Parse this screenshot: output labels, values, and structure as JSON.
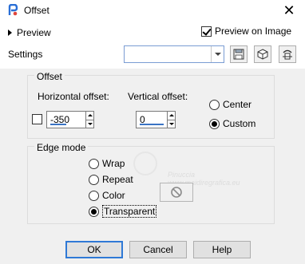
{
  "window": {
    "title": "Offset",
    "close_glyph": "✕"
  },
  "top": {
    "preview_label": "Preview",
    "preview_on_image_label": "Preview on Image",
    "preview_on_image_checked": true,
    "settings_label": "Settings",
    "settings_value": ""
  },
  "offset": {
    "group_title": "Offset",
    "horizontal_label": "Horizontal offset:",
    "horizontal_value": "-350",
    "vertical_label": "Vertical offset:",
    "vertical_value": "0",
    "center_label": "Center",
    "custom_label": "Custom",
    "selected": "Custom"
  },
  "edge_mode": {
    "group_title": "Edge mode",
    "options": [
      "Wrap",
      "Repeat",
      "Color",
      "Transparent"
    ],
    "selected": "Transparent"
  },
  "watermark": {
    "line1": "Pinuccia",
    "line2": "www.maidiregrafica.eu"
  },
  "buttons": {
    "ok": "OK",
    "cancel": "Cancel",
    "help": "Help"
  },
  "colors": {
    "accent": "#2f79d6",
    "dialog_bg": "#f0f0f0",
    "title_bg": "#ffffff"
  },
  "icons": [
    "app-icon",
    "close-icon",
    "expand-triangle-icon",
    "save-preset-icon",
    "reset-icon",
    "delete-preset-icon",
    "no-color-icon"
  ]
}
